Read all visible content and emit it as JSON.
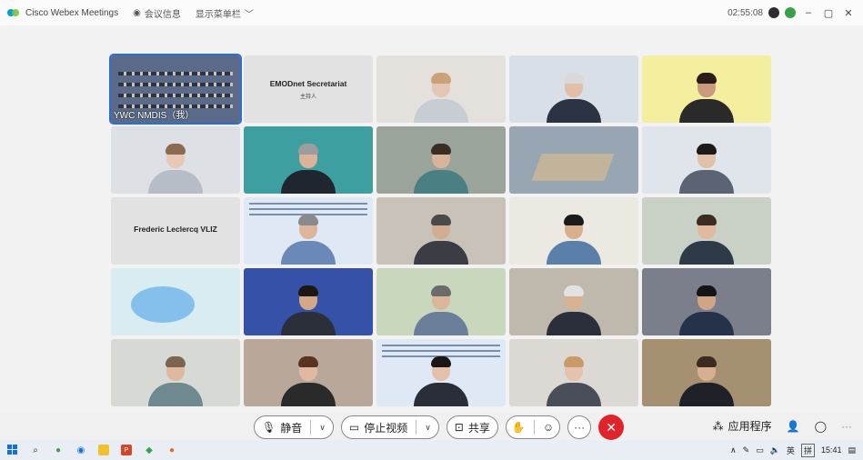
{
  "titlebar": {
    "app_name": "Cisco Webex Meetings",
    "meeting_info": "会议信息",
    "show_menu": "显示菜单栏",
    "timer": "02:55:08"
  },
  "tiles": [
    {
      "kind": "video",
      "label": "YWC NMDIS（我）",
      "bg": "#5a6a88",
      "scene": "room"
    },
    {
      "kind": "text",
      "name": "EMODnet Secretariat",
      "role": "主持人"
    },
    {
      "kind": "video",
      "bg": "#e4e1dd",
      "skin": "#e5c6b5",
      "hair": "#c9a27a",
      "body": "#c8ccd3",
      "scene": "person"
    },
    {
      "kind": "video",
      "bg": "#d9dfe6",
      "skin": "#e2bea7",
      "hair": "#d9d9d9",
      "body": "#2c3443",
      "scene": "person"
    },
    {
      "kind": "video",
      "bg": "#f4ee9f",
      "skin": "#c99b7c",
      "hair": "#2a1d16",
      "body": "#2a2a2a",
      "scene": "person"
    },
    {
      "kind": "video",
      "bg": "#dde1e6",
      "skin": "#e9c8b7",
      "hair": "#8c6a50",
      "body": "#b7bdc7",
      "scene": "person"
    },
    {
      "kind": "video",
      "bg": "#3d9fa0",
      "skin": "#dcb29a",
      "hair": "#9d9d9d",
      "body": "#1f2630",
      "scene": "person"
    },
    {
      "kind": "video",
      "bg": "#9aa49b",
      "skin": "#d8b49a",
      "hair": "#3a2d24",
      "body": "#4a7f84",
      "scene": "person"
    },
    {
      "kind": "video",
      "bg": "#98a6b4",
      "scene": "table"
    },
    {
      "kind": "video",
      "bg": "#dfe5ea",
      "skin": "#e2c1a9",
      "hair": "#1e1a1a",
      "body": "#5a6472",
      "scene": "person"
    },
    {
      "kind": "text",
      "name": "Frederic Leclercq VLIZ",
      "role": ""
    },
    {
      "kind": "video",
      "bg": "#dfe9f5",
      "skin": "#dcb59c",
      "hair": "#8a8a8a",
      "body": "#6b89b8",
      "scene": "slide"
    },
    {
      "kind": "video",
      "bg": "#c8c2b8",
      "skin": "#d3ad92",
      "hair": "#4a4a4a",
      "body": "#3a3d44",
      "scene": "person"
    },
    {
      "kind": "video",
      "bg": "#ece8e2",
      "skin": "#d9b08f",
      "hair": "#1b1b1b",
      "body": "#5a7fa8",
      "scene": "person"
    },
    {
      "kind": "video",
      "bg": "#c9d0c5",
      "skin": "#e0b99e",
      "hair": "#3b2b20",
      "body": "#2f3a48",
      "scene": "person"
    },
    {
      "kind": "video",
      "bg": "#d9ecf2",
      "scene": "blur"
    },
    {
      "kind": "video",
      "bg": "#3552a8",
      "skin": "#d2a987",
      "hair": "#1d1714",
      "body": "#2a2f3a",
      "scene": "person"
    },
    {
      "kind": "video",
      "bg": "#c9d8bd",
      "skin": "#dcb69b",
      "hair": "#6b6b6b",
      "body": "#6b7f9a",
      "scene": "person"
    },
    {
      "kind": "video",
      "bg": "#bfb9ad",
      "skin": "#d8b192",
      "hair": "#e2e2e2",
      "body": "#2b2f3b",
      "scene": "person"
    },
    {
      "kind": "video",
      "bg": "#7b7f8c",
      "skin": "#cfa585",
      "hair": "#141414",
      "body": "#26324a",
      "scene": "person"
    },
    {
      "kind": "video",
      "bg": "#d7d9d5",
      "skin": "#dfb99f",
      "hair": "#7b6450",
      "body": "#6e8a90",
      "scene": "person"
    },
    {
      "kind": "video",
      "bg": "#b9a89a",
      "skin": "#e0b9a0",
      "hair": "#5a3423",
      "body": "#2a2a2a",
      "scene": "person"
    },
    {
      "kind": "video",
      "bg": "#dfe9f5",
      "skin": "#e3c0a6",
      "hair": "#1a1616",
      "body": "#2a2e38",
      "scene": "slide"
    },
    {
      "kind": "video",
      "bg": "#dcd8d3",
      "skin": "#e4c2ad",
      "hair": "#c99a6a",
      "body": "#4a4e58",
      "scene": "person"
    },
    {
      "kind": "video",
      "bg": "#a69072",
      "skin": "#d7b092",
      "hair": "#3b2b20",
      "body": "#1e2228",
      "scene": "person"
    }
  ],
  "toolbar": {
    "mute_label": "静音",
    "stop_video_label": "停止视频",
    "share_label": "共享",
    "apps_label": "应用程序"
  },
  "taskbar": {
    "ime_lang": "英",
    "ime_mode": "拼",
    "clock": "15:41"
  }
}
